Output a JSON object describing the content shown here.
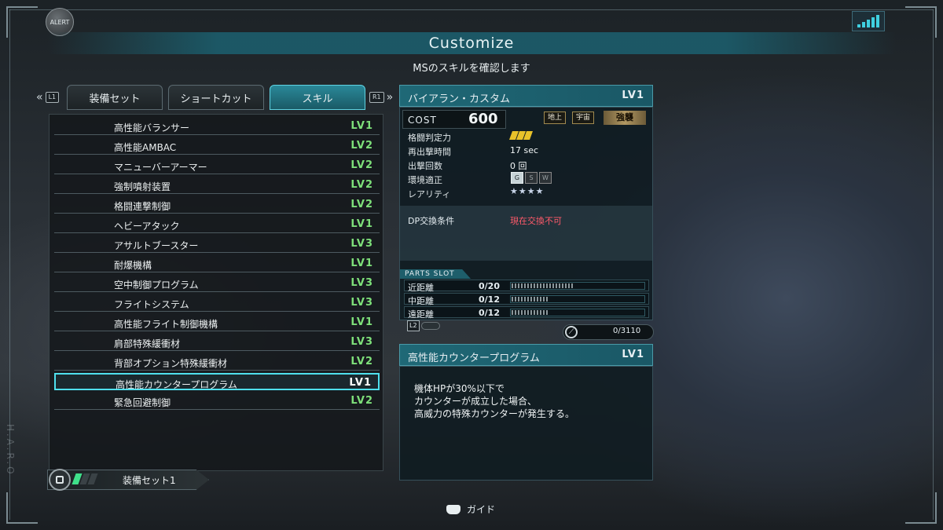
{
  "alert": "ALERT",
  "title": "Customize",
  "subtitle": "MSのスキルを確認します",
  "side_text": "H.A.R.O",
  "shoulder_left": "L1",
  "shoulder_right": "R1",
  "tabs": [
    {
      "label": "装備セット",
      "active": false
    },
    {
      "label": "ショートカット",
      "active": false
    },
    {
      "label": "スキル",
      "active": true
    }
  ],
  "skills": [
    {
      "name": "高性能バランサー",
      "lv": "LV1",
      "lv_color": "#7ee07a"
    },
    {
      "name": "高性能AMBAC",
      "lv": "LV2",
      "lv_color": "#7ee07a"
    },
    {
      "name": "マニューバーアーマー",
      "lv": "LV2",
      "lv_color": "#7ee07a"
    },
    {
      "name": "強制噴射装置",
      "lv": "LV2",
      "lv_color": "#7ee07a"
    },
    {
      "name": "格闘連撃制御",
      "lv": "LV2",
      "lv_color": "#7ee07a"
    },
    {
      "name": "ヘビーアタック",
      "lv": "LV1",
      "lv_color": "#7ee07a"
    },
    {
      "name": "アサルトブースター",
      "lv": "LV3",
      "lv_color": "#7ee07a"
    },
    {
      "name": "耐爆機構",
      "lv": "LV1",
      "lv_color": "#7ee07a"
    },
    {
      "name": "空中制御プログラム",
      "lv": "LV3",
      "lv_color": "#7ee07a"
    },
    {
      "name": "フライトシステム",
      "lv": "LV3",
      "lv_color": "#7ee07a"
    },
    {
      "name": "高性能フライト制御機構",
      "lv": "LV1",
      "lv_color": "#7ee07a"
    },
    {
      "name": "肩部特殊緩衝材",
      "lv": "LV3",
      "lv_color": "#7ee07a"
    },
    {
      "name": "背部オプション特殊緩衝材",
      "lv": "LV2",
      "lv_color": "#7ee07a"
    },
    {
      "name": "高性能カウンタープログラム",
      "lv": "LV1",
      "lv_color": "#ffffff",
      "selected": true
    },
    {
      "name": "緊急回避制御",
      "lv": "LV2",
      "lv_color": "#7ee07a"
    }
  ],
  "loadout": {
    "label": "装備セット1",
    "bars_on": 1,
    "bars_total": 3
  },
  "ms": {
    "name": "バイアラン・カスタム",
    "lv": "LV1",
    "cost_label": "COST",
    "cost_value": "600",
    "env_tags": [
      "地上",
      "宇宙"
    ],
    "badge": "強襲",
    "stats": [
      {
        "label": "格闘判定力",
        "value": ""
      },
      {
        "label": "再出撃時間",
        "value": "17 sec"
      },
      {
        "label": "出撃回数",
        "value": "0 回"
      },
      {
        "label": "環境適正",
        "value": ""
      },
      {
        "label": "レアリティ",
        "value": "★★★★"
      }
    ],
    "melee_level": 3,
    "env_icons": [
      {
        "label": "G",
        "active": true
      },
      {
        "label": "S",
        "active": false
      },
      {
        "label": "W",
        "active": false
      }
    ],
    "dp_label": "DP交換条件",
    "dp_value": "現在交換不可",
    "parts_title": "PARTS SLOT",
    "parts": [
      {
        "label": "近距離",
        "value": "0/20",
        "fill": 0.46
      },
      {
        "label": "中距離",
        "value": "0/12",
        "fill": 0.28
      },
      {
        "label": "遠距離",
        "value": "0/12",
        "fill": 0.28
      }
    ],
    "l2_tag": "L2",
    "capacity": "0/3110"
  },
  "skill_detail": {
    "name": "高性能カウンタープログラム",
    "lv": "LV1",
    "desc": [
      "機体HPが30%以下で",
      "カウンターが成立した場合、",
      "高威力の特殊カウンターが発生する。"
    ]
  },
  "guide_label": "ガイド"
}
